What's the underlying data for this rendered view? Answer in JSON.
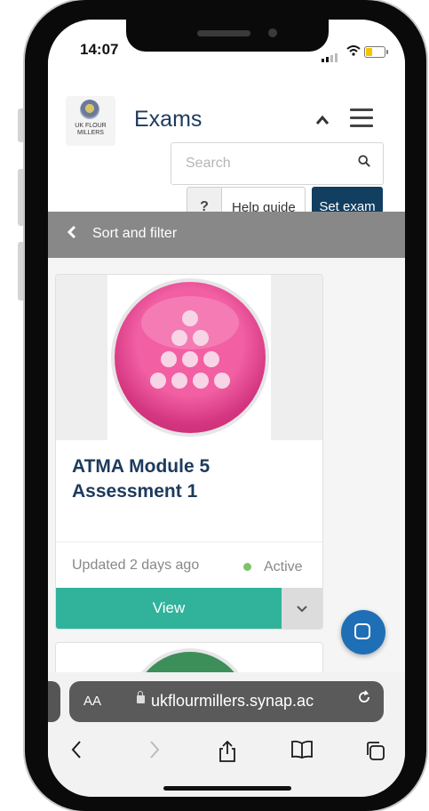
{
  "status_bar": {
    "time": "14:07"
  },
  "header": {
    "logo_text": "UK FLOUR MILLERS",
    "title": "Exams",
    "search_placeholder": "Search",
    "help_icon": "?",
    "help_label": "Help guide",
    "set_exam_label": "Set exam"
  },
  "filter_bar": {
    "label": "Sort and filter"
  },
  "cards": [
    {
      "title": "ATMA Module 5 Assessment 1",
      "updated": "Updated 2 days ago",
      "status": "Active",
      "view_label": "View",
      "badge_color": "#d3357f",
      "status_color": "#7cc36b"
    }
  ],
  "safari": {
    "aa_label": "AA",
    "url": "ukflourmillers.synap.ac"
  },
  "colors": {
    "primary": "#123e60",
    "accent": "#30b39a",
    "chat": "#1f6fb6"
  },
  "icons": [
    "back-icon",
    "forward-icon",
    "share-icon",
    "bookmarks-icon",
    "tabs-icon",
    "reload-icon",
    "lock-icon",
    "search-icon",
    "chat-icon"
  ]
}
